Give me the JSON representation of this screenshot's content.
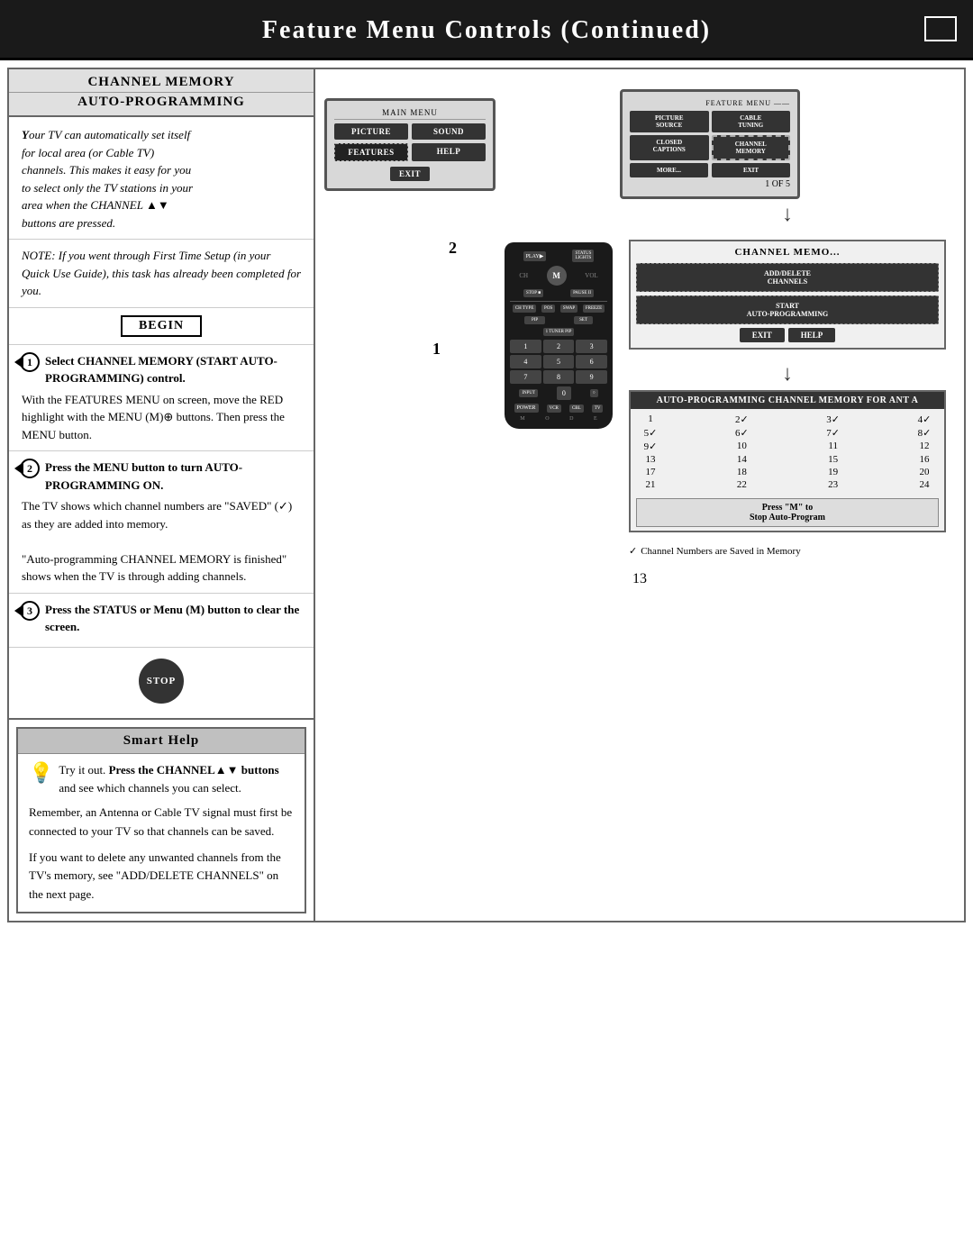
{
  "header": {
    "title": "Feature Menu Controls (Continued)",
    "corner": ""
  },
  "left": {
    "channel_memory_header": "CHANNEL MEMORY",
    "auto_programming_header": "AUTO-PROGRAMMING",
    "intro": {
      "line1": "Your TV can automatically set itself",
      "line2": "for local area (or Cable TV)",
      "line3": "channels. This makes it easy for you",
      "line4": "to select only the TV stations in your",
      "line5": "area when the CHANNEL ▲▼",
      "line6": "buttons are pressed."
    },
    "note": "NOTE: If you went through First Time Setup (in your Quick Use Guide), this task has already been completed for you.",
    "begin_label": "BEGIN",
    "steps": [
      {
        "num": "1",
        "header": "Select CHANNEL MEMORY (START AUTO-PROGRAMMING) control.",
        "body": "With the FEATURES MENU on screen, move the RED highlight with the MENU (M)⊕ buttons. Then press the MENU button."
      },
      {
        "num": "2",
        "header": "Press the MENU button to turn AUTO-PROGRAMMING ON.",
        "body": "The TV shows which channel numbers are \"SAVED\" (✓) as they are added into memory.\n\"Auto-programming CHANNEL MEMORY is finished\" shows when the TV is through adding channels."
      },
      {
        "num": "3",
        "header": "Press the STATUS or Menu (M) button to clear the screen.",
        "body": ""
      }
    ],
    "stop_label": "STOP",
    "smart_help": {
      "header": "Smart Help",
      "tip1_bold": "Try it out. Press the CHANNEL▲▼ buttons",
      "tip1_rest": "and see which channels you can select.",
      "tip2": "Remember, an Antenna or Cable TV signal must first be connected to your TV so that channels can be saved.",
      "tip3": "If you want to delete any unwanted channels from the TV's memory, see \"ADD/DELETE CHANNELS\" on the next page."
    }
  },
  "diagrams": {
    "main_menu": {
      "label": "MAIN MENU",
      "buttons": [
        "PICTURE",
        "SOUND",
        "FEATURES",
        "HELP",
        "EXIT"
      ]
    },
    "feature_menu": {
      "label": "FEATURE MENU",
      "buttons": [
        "PICTURE SOURCE",
        "CABLE TUNING",
        "CLOSED CAPTIONS",
        "CHANNEL MEMORY",
        "MORE...",
        "EXIT"
      ],
      "page": "1 OF 5"
    },
    "channel_memory_panel": {
      "title": "CHANNEL MEMO...",
      "buttons": [
        "ADD/DELETE CHANNELS",
        "START AUTO-PROGRAMMING",
        "EXIT",
        "HELP"
      ]
    },
    "auto_prog": {
      "title": "AUTO-PROGRAMMING CHANNEL MEMORY FOR ANT A",
      "rows": [
        [
          "1",
          "2✓",
          "3✓",
          "4✓"
        ],
        [
          "5✓",
          "6✓",
          "7✓",
          "8✓"
        ],
        [
          "9✓",
          "10",
          "11",
          "12"
        ],
        [
          "13",
          "14",
          "15",
          "16"
        ],
        [
          "17",
          "18",
          "19",
          "20"
        ],
        [
          "21",
          "22",
          "23",
          "24"
        ]
      ],
      "press_m": "Press \"M\" to\nStop Auto-Program"
    },
    "channel_note": "Channel Numbers are Saved in Memory"
  },
  "page_number": "13"
}
